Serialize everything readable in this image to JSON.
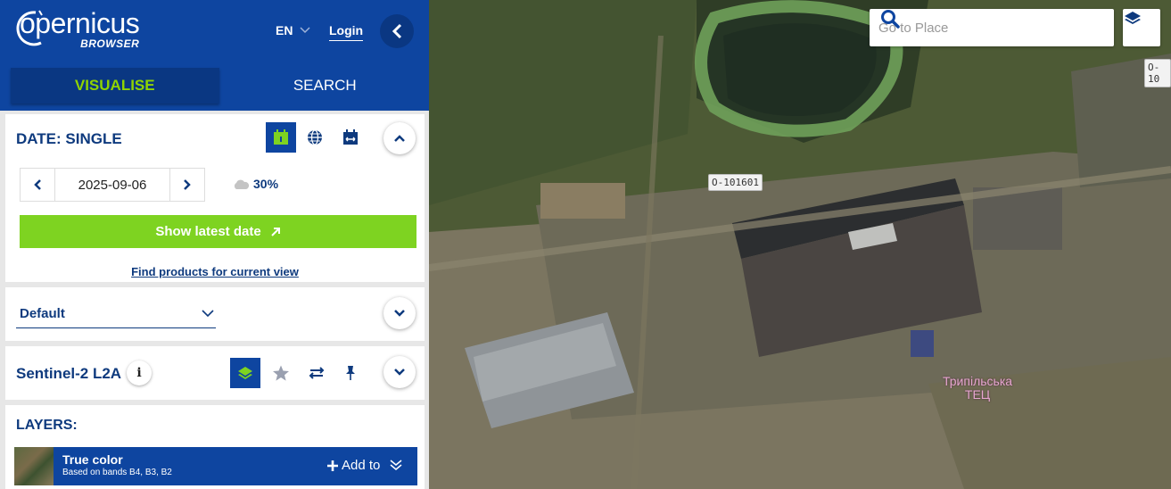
{
  "app": {
    "brand": "opernicus",
    "subtitle": "BROWSER"
  },
  "header": {
    "lang": "EN",
    "login": "Login"
  },
  "tabs": [
    {
      "label": "VISUALISE",
      "active": true
    },
    {
      "label": "SEARCH",
      "active": false
    }
  ],
  "date_panel": {
    "title": "DATE: SINGLE",
    "date": "2025-09-06",
    "cloud": "30%",
    "latest_button": "Show latest date",
    "find_link": "Find products for current view"
  },
  "theme": {
    "selected": "Default"
  },
  "collection": {
    "title": "Sentinel-2 L2A",
    "info": "i"
  },
  "layers": {
    "title": "LAYERS:",
    "items": [
      {
        "name": "True color",
        "desc": "Based on bands B4, B3, B2",
        "add_label": "Add to"
      }
    ]
  },
  "search": {
    "placeholder": "Go to Place"
  },
  "map": {
    "label_a": "O-101601",
    "label_b": "O-10",
    "place_line1": "Трипільська",
    "place_line2": "ТЕЦ"
  },
  "colors": {
    "primary": "#0e45a0",
    "accent": "#7ed321",
    "tab_active_text": "#8fd400"
  }
}
